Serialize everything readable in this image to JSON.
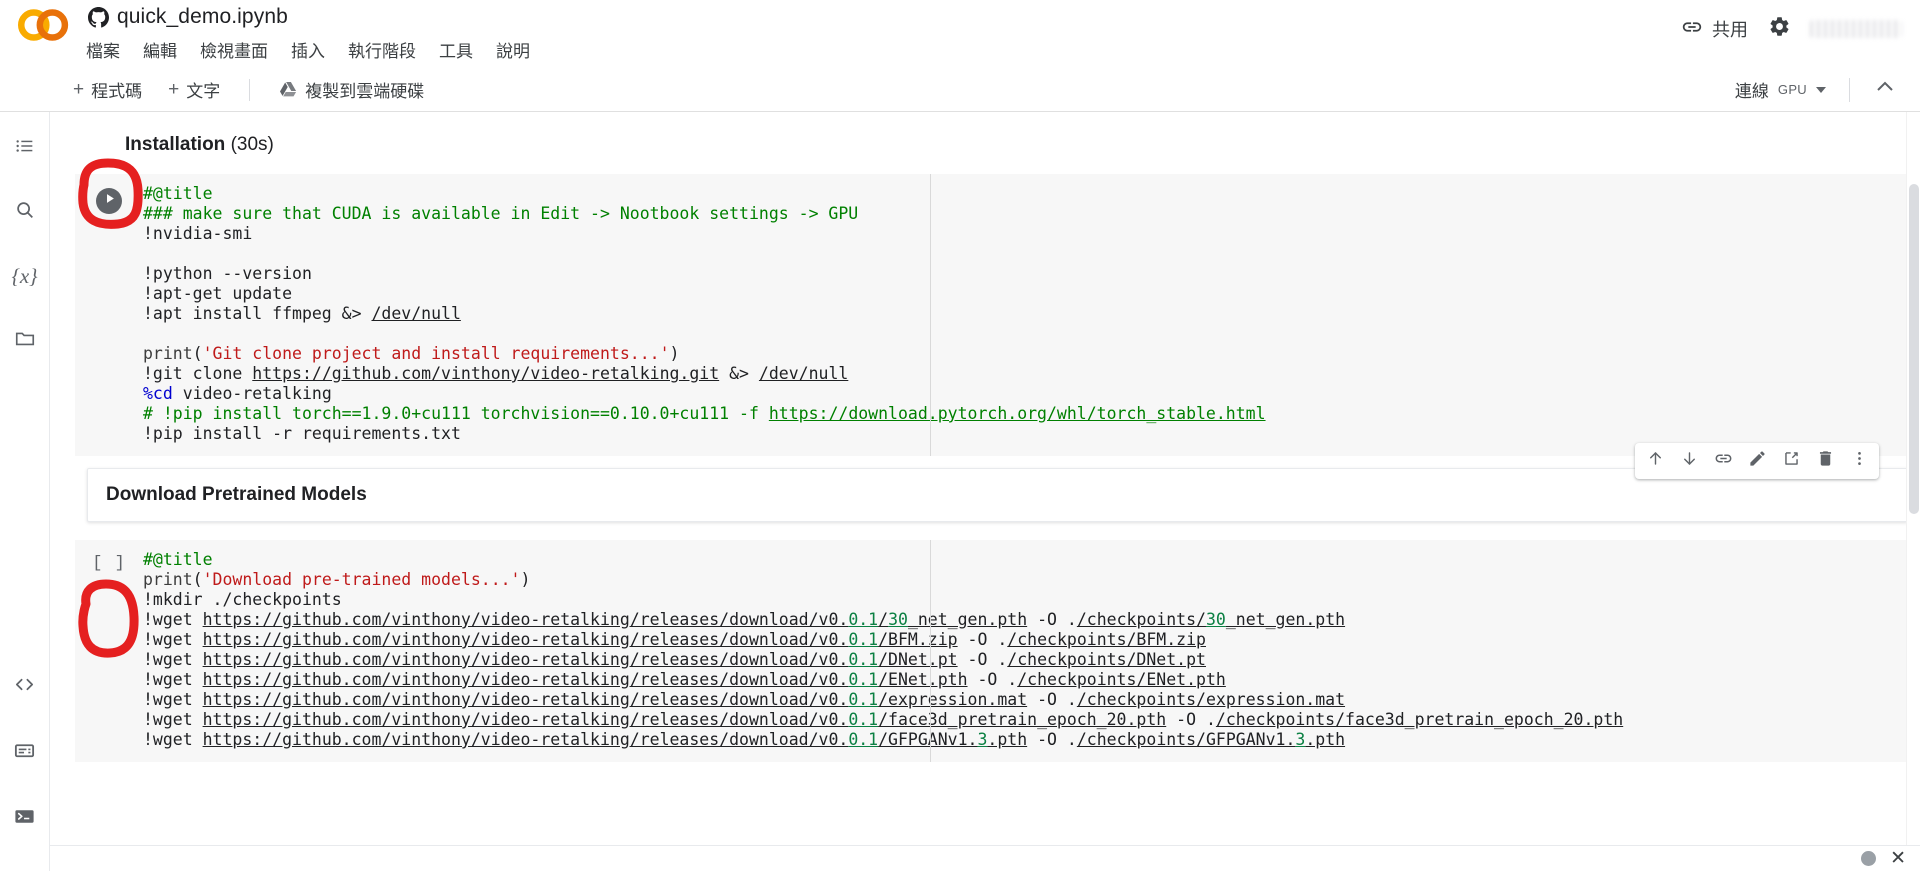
{
  "app": {
    "logo_name": "colab-logo",
    "document_title": "quick_demo.ipynb",
    "document_icon": "github-icon"
  },
  "menubar": {
    "items": [
      {
        "label": "檔案",
        "name": "menu-file"
      },
      {
        "label": "編輯",
        "name": "menu-edit"
      },
      {
        "label": "檢視畫面",
        "name": "menu-view"
      },
      {
        "label": "插入",
        "name": "menu-insert"
      },
      {
        "label": "執行階段",
        "name": "menu-runtime"
      },
      {
        "label": "工具",
        "name": "menu-tools"
      },
      {
        "label": "說明",
        "name": "menu-help"
      }
    ]
  },
  "header_right": {
    "share_label": "共用",
    "share_icon": "link-icon",
    "settings_icon": "gear-icon",
    "avatar": "account-avatar-blurred"
  },
  "toolbar": {
    "add_code_label": "程式碼",
    "add_text_label": "文字",
    "copy_to_drive_label": "複製到雲端硬碟",
    "connect_label": "連線",
    "connect_accelerator": "GPU",
    "collapse_icon": "chevron-up-icon"
  },
  "sidebar": {
    "items": [
      {
        "name": "sidebar-item-toc",
        "icon": "list-icon"
      },
      {
        "name": "sidebar-item-search",
        "icon": "search-icon"
      },
      {
        "name": "sidebar-item-variables",
        "icon": "variables-icon",
        "glyph": "{x}"
      },
      {
        "name": "sidebar-item-files",
        "icon": "folder-icon"
      }
    ],
    "bottom_items": [
      {
        "name": "sidebar-item-code-snippets",
        "icon": "code-brackets-icon",
        "glyph": "<>"
      },
      {
        "name": "sidebar-item-command-palette",
        "icon": "command-palette-icon"
      },
      {
        "name": "sidebar-item-terminal",
        "icon": "terminal-icon"
      }
    ]
  },
  "notebook": {
    "section1": {
      "title_bold": "Installation",
      "title_sub": " (30s)"
    },
    "cell1": {
      "run_icon": "play-icon",
      "lines": [
        [
          {
            "t": "#@title",
            "c": "cm"
          }
        ],
        [
          {
            "t": "### make sure that CUDA is available in Edit -> Nootbook settings -> GPU",
            "c": "cm"
          }
        ],
        [
          {
            "t": "!nvidia-smi",
            "c": ""
          }
        ],
        [
          {
            "t": "",
            "c": ""
          }
        ],
        [
          {
            "t": "!python --version",
            "c": ""
          }
        ],
        [
          {
            "t": "!apt-get update",
            "c": ""
          }
        ],
        [
          {
            "t": "!apt install ffmpeg &> ",
            "c": ""
          },
          {
            "t": "/dev/null",
            "c": "path"
          }
        ],
        [
          {
            "t": "",
            "c": ""
          }
        ],
        [
          {
            "t": "print",
            "c": "fn"
          },
          {
            "t": "(",
            "c": ""
          },
          {
            "t": "'Git clone project and install requirements...'",
            "c": "str"
          },
          {
            "t": ")",
            "c": ""
          }
        ],
        [
          {
            "t": "!git clone ",
            "c": ""
          },
          {
            "t": "https://github.com/vinthony/video-retalking.git",
            "c": "path"
          },
          {
            "t": " &> ",
            "c": ""
          },
          {
            "t": "/dev/null",
            "c": "path"
          }
        ],
        [
          {
            "t": "%cd",
            "c": "kw"
          },
          {
            "t": " video-retalking",
            "c": ""
          }
        ],
        [
          {
            "t": "# !pip install torch==1.9.0+cu111 torchvision==0.10.0+cu111 -f ",
            "c": "cm"
          },
          {
            "t": "https://download.pytorch.org/whl/torch_stable.html",
            "c": "lnk-g"
          }
        ],
        [
          {
            "t": "!pip install -r requirements.txt",
            "c": ""
          }
        ]
      ]
    },
    "section2": {
      "md_text": "Download Pretrained Models"
    },
    "cell2": {
      "index_label": "[ ]",
      "lines": [
        [
          {
            "t": "#@title",
            "c": "cm"
          }
        ],
        [
          {
            "t": "print",
            "c": "fn"
          },
          {
            "t": "(",
            "c": ""
          },
          {
            "t": "'Download pre-trained models...'",
            "c": "str"
          },
          {
            "t": ")",
            "c": ""
          }
        ],
        [
          {
            "t": "!mkdir ./checkpoints",
            "c": ""
          }
        ],
        [
          {
            "t": "!wget ",
            "c": ""
          },
          {
            "t": "https://github.com/vinthony/video-retalking/releases/download/v0.",
            "c": "path"
          },
          {
            "t": "0.1",
            "c": "num lnk"
          },
          {
            "t": "/",
            "c": "path"
          },
          {
            "t": "30",
            "c": "num lnk"
          },
          {
            "t": "_net_gen.pth",
            "c": "path"
          },
          {
            "t": " -O ",
            "c": ""
          },
          {
            "t": ".",
            "c": ""
          },
          {
            "t": "/checkpoints/",
            "c": "path"
          },
          {
            "t": "30",
            "c": "num lnk"
          },
          {
            "t": "_net_gen.pth",
            "c": "path"
          }
        ],
        [
          {
            "t": "!wget ",
            "c": ""
          },
          {
            "t": "https://github.com/vinthony/video-retalking/releases/download/v0.",
            "c": "path"
          },
          {
            "t": "0.1",
            "c": "num lnk"
          },
          {
            "t": "/BFM.zip",
            "c": "path"
          },
          {
            "t": " -O ",
            "c": ""
          },
          {
            "t": ".",
            "c": ""
          },
          {
            "t": "/checkpoints/BFM.zip",
            "c": "path"
          }
        ],
        [
          {
            "t": "!wget ",
            "c": ""
          },
          {
            "t": "https://github.com/vinthony/video-retalking/releases/download/v0.",
            "c": "path"
          },
          {
            "t": "0.1",
            "c": "num lnk"
          },
          {
            "t": "/DNet.pt",
            "c": "path"
          },
          {
            "t": " -O ",
            "c": ""
          },
          {
            "t": ".",
            "c": ""
          },
          {
            "t": "/checkpoints/DNet.pt",
            "c": "path"
          }
        ],
        [
          {
            "t": "!wget ",
            "c": ""
          },
          {
            "t": "https://github.com/vinthony/video-retalking/releases/download/v0.",
            "c": "path"
          },
          {
            "t": "0.1",
            "c": "num lnk"
          },
          {
            "t": "/ENet.pth",
            "c": "path"
          },
          {
            "t": " -O ",
            "c": ""
          },
          {
            "t": ".",
            "c": ""
          },
          {
            "t": "/checkpoints/ENet.pth",
            "c": "path"
          }
        ],
        [
          {
            "t": "!wget ",
            "c": ""
          },
          {
            "t": "https://github.com/vinthony/video-retalking/releases/download/v0.",
            "c": "path"
          },
          {
            "t": "0.1",
            "c": "num lnk"
          },
          {
            "t": "/expression.mat",
            "c": "path"
          },
          {
            "t": " -O ",
            "c": ""
          },
          {
            "t": ".",
            "c": ""
          },
          {
            "t": "/checkpoints/expression.mat",
            "c": "path"
          }
        ],
        [
          {
            "t": "!wget ",
            "c": ""
          },
          {
            "t": "https://github.com/vinthony/video-retalking/releases/download/v0.",
            "c": "path"
          },
          {
            "t": "0.1",
            "c": "num lnk"
          },
          {
            "t": "/face3d_pretrain_epoch_20.pth",
            "c": "path"
          },
          {
            "t": " -O ",
            "c": ""
          },
          {
            "t": ".",
            "c": ""
          },
          {
            "t": "/checkpoints/face3d_pretrain_epoch_20.pth",
            "c": "path"
          }
        ],
        [
          {
            "t": "!wget ",
            "c": ""
          },
          {
            "t": "https://github.com/vinthony/video-retalking/releases/download/v0.",
            "c": "path"
          },
          {
            "t": "0.1",
            "c": "num lnk"
          },
          {
            "t": "/GFPGANv1.",
            "c": "path"
          },
          {
            "t": "3",
            "c": "num lnk"
          },
          {
            "t": ".pth",
            "c": "path"
          },
          {
            "t": " -O ",
            "c": ""
          },
          {
            "t": ".",
            "c": ""
          },
          {
            "t": "/checkpoints/GFPGANv1.",
            "c": "path"
          },
          {
            "t": "3",
            "c": "num lnk"
          },
          {
            "t": ".pth",
            "c": "path"
          }
        ]
      ]
    }
  },
  "cell_toolbar": {
    "buttons": [
      {
        "name": "move-cell-up-button",
        "icon": "arrow-up-icon"
      },
      {
        "name": "move-cell-down-button",
        "icon": "arrow-down-icon"
      },
      {
        "name": "copy-cell-link-button",
        "icon": "link-icon"
      },
      {
        "name": "edit-cell-button",
        "icon": "pencil-icon"
      },
      {
        "name": "open-in-tab-button",
        "icon": "open-in-new-icon"
      },
      {
        "name": "delete-cell-button",
        "icon": "trash-icon"
      },
      {
        "name": "cell-more-options-button",
        "icon": "more-vert-icon"
      }
    ]
  },
  "annotations": {
    "highlight_color": "#e52020",
    "items": [
      {
        "name": "annotation-circle-run-button"
      },
      {
        "name": "annotation-circle-cell-index"
      }
    ]
  },
  "statusbar": {
    "close_glyph": "✕",
    "indicator": "status-dot"
  }
}
